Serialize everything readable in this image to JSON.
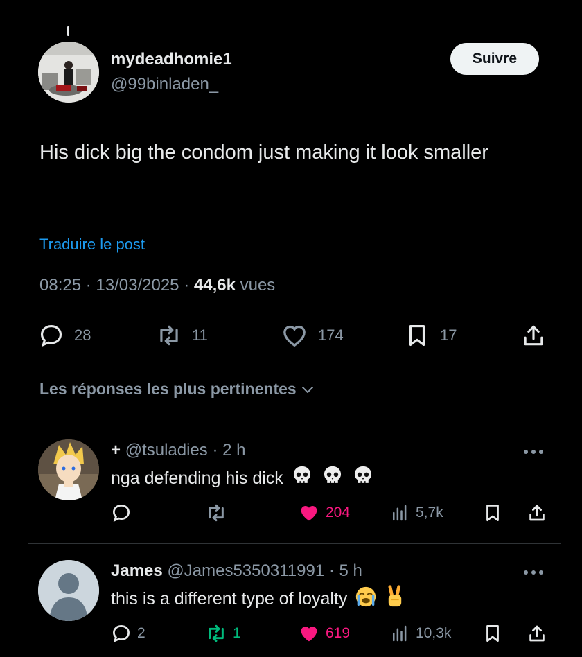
{
  "tweet": {
    "author_name": "mydeadhomie1",
    "author_handle": "@99binladen_",
    "follow_label": "Suivre",
    "text": "His dick big the condom just making it look smaller",
    "translate_label": "Traduire le post",
    "time": "08:25",
    "date": "13/03/2025",
    "views_count": "44,6k",
    "views_label": "vues",
    "replies": "28",
    "reposts": "11",
    "likes": "174",
    "bookmarks": "17"
  },
  "sort_label": "Les réponses les plus pertinentes",
  "replies": [
    {
      "prefix": "+",
      "display_name": "",
      "handle": "@tsuladies",
      "time": "2 h",
      "text": "nga defending his dick",
      "emojis": [
        "skull",
        "skull",
        "skull"
      ],
      "reply_count": "",
      "repost_count": "",
      "like_count": "204",
      "views": "5,7k",
      "liked": true
    },
    {
      "prefix": "",
      "display_name": "James",
      "handle": "@James5350311991",
      "time": "5 h",
      "text": "this is a different type of loyalty",
      "emojis": [
        "loudly-crying-face",
        "victory-hand"
      ],
      "reply_count": "2",
      "repost_count": "1",
      "like_count": "619",
      "views": "10,3k",
      "liked": true,
      "reposted": true
    }
  ],
  "colors": {
    "background": "#000000",
    "text": "#e7e9ea",
    "muted": "#8b98a5",
    "link": "#1d9bf0",
    "like": "#f91880",
    "repost": "#00ba7c"
  }
}
